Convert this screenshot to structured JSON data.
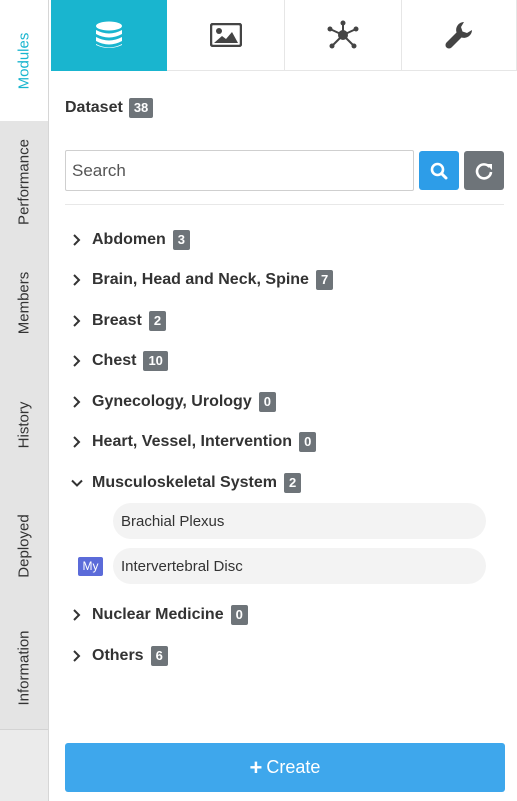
{
  "side_tabs": [
    {
      "label": "Modules",
      "active": true
    },
    {
      "label": "Performance",
      "active": false
    },
    {
      "label": "Members",
      "active": false
    },
    {
      "label": "History",
      "active": false
    },
    {
      "label": "Deployed",
      "active": false
    },
    {
      "label": "Information",
      "active": false
    }
  ],
  "top_tabs": [
    {
      "icon": "database-icon",
      "active": true
    },
    {
      "icon": "image-icon",
      "active": false
    },
    {
      "icon": "network-icon",
      "active": false
    },
    {
      "icon": "wrench-icon",
      "active": false
    }
  ],
  "dataset": {
    "title": "Dataset",
    "count": "38"
  },
  "search": {
    "placeholder": "Search",
    "value": ""
  },
  "categories": [
    {
      "label": "Abdomen",
      "count": "3",
      "expanded": false
    },
    {
      "label": "Brain, Head and Neck, Spine",
      "count": "7",
      "expanded": false
    },
    {
      "label": "Breast",
      "count": "2",
      "expanded": false
    },
    {
      "label": "Chest",
      "count": "10",
      "expanded": false
    },
    {
      "label": "Gynecology, Urology",
      "count": "0",
      "expanded": false
    },
    {
      "label": "Heart, Vessel, Intervention",
      "count": "0",
      "expanded": false
    },
    {
      "label": "Musculoskeletal System",
      "count": "2",
      "expanded": true,
      "items": [
        {
          "label": "Brachial Plexus",
          "badge": ""
        },
        {
          "label": "Intervertebral Disc",
          "badge": "My"
        }
      ]
    },
    {
      "label": "Nuclear Medicine",
      "count": "0",
      "expanded": false
    },
    {
      "label": "Others",
      "count": "6",
      "expanded": false
    }
  ],
  "create_button": {
    "label": "Create",
    "icon": "plus-icon"
  },
  "colors": {
    "accent": "#19b5cf",
    "primary": "#3ea7ec",
    "badge": "#6e7479",
    "my_badge": "#5b6bd9"
  }
}
